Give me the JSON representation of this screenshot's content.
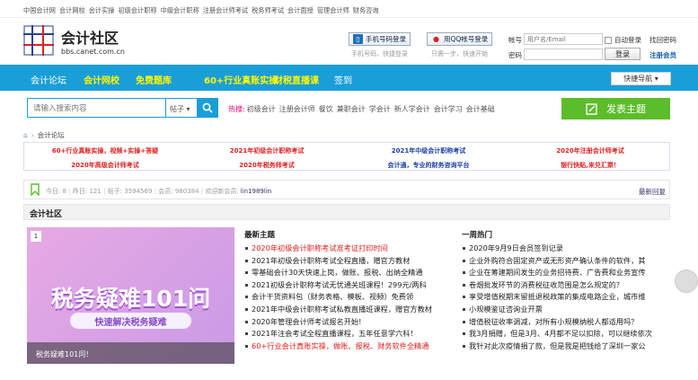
{
  "topbar": {
    "links": [
      "中国会计网",
      "会计网校",
      "会计实操",
      "初级会计职称",
      "中级会计职称",
      "注册会计师考试",
      "税务师考试",
      "会计面授",
      "管理会计师",
      "财务咨询"
    ]
  },
  "logo": {
    "title": "会计社区",
    "domain": "bbs.canet.com.cn"
  },
  "login": {
    "phone_btn": "手机号码登录",
    "phone_sub": "手机号码，快捷登录",
    "qq_btn": "用QQ帐号登录",
    "qq_sub": "只需一步，快速开始",
    "acct_label": "帐号",
    "acct_placeholder": "用户名/Email",
    "auto_login": "自动登录",
    "find_pwd": "找回密码",
    "pwd_label": "密码",
    "login_btn": "登录",
    "register": "注册会员"
  },
  "nav": {
    "items": [
      {
        "label": "会计论坛",
        "hl": false
      },
      {
        "label": "会计网校",
        "hl": true
      },
      {
        "label": "免费题库",
        "hl": true
      },
      {
        "label": "60+行业真账实操",
        "hl": true
      },
      {
        "label": "财税直播课",
        "hl": true
      },
      {
        "label": "签到",
        "hl": false
      }
    ],
    "quick": "快捷导航"
  },
  "search": {
    "placeholder": "请输入搜索内容",
    "select": "帖子",
    "hot_label": "热搜:",
    "hot": [
      "初级会计",
      "注册会计师",
      "餐饮",
      "兼职会计",
      "学会计",
      "新人学会计",
      "会计学习",
      "会计基础"
    ],
    "post_btn": "发表主题"
  },
  "breadcrumb": {
    "current": "会计论坛"
  },
  "promo": [
    {
      "text": "60+行业真账实操，视频+实操+答疑",
      "color": "#e02020"
    },
    {
      "text": "2021年初级会计职称考试",
      "color": "#e02020"
    },
    {
      "text": "2021年中级会计职称考试",
      "color": "#1a3ea8"
    },
    {
      "text": "2020年注册会计师考试",
      "color": "#e02020"
    },
    {
      "text": "2020年高级会计师考试",
      "color": "#e02020"
    },
    {
      "text": "2020年税务师考试",
      "color": "#e02020"
    },
    {
      "text": "会计通，专业的财务咨询平台",
      "color": "#1a3ea8"
    },
    {
      "text": "银行快贴,来兑汇票！",
      "color": "#e02020"
    }
  ],
  "stats": {
    "today_label": "今日: 8",
    "yest": "昨日: 121",
    "posts": "帖子: 3594569",
    "members": "会员: 980384",
    "welcome": "欢迎新会员:",
    "newest": "lin1989lin",
    "latest": "最新回复"
  },
  "section": {
    "title": "会计社区"
  },
  "banner": {
    "index": "1",
    "big": "税务疑难101问",
    "small": "快速解决税务疑难",
    "caption": "税务疑难101问！"
  },
  "new_topics": {
    "title": "最新主题",
    "items": [
      {
        "text": "2020年初级会计职称考试准考证打印时间",
        "red": true
      },
      {
        "text": "2021年初级会计职称考试全程直播，赠官方教材",
        "red": false
      },
      {
        "text": "零基础会计30天快速上岗，做账、报税、出纳全精通",
        "red": false
      },
      {
        "text": "2021初级会计职称考试无忧通关班课程！299元/两科",
        "red": false
      },
      {
        "text": "会计干货资料包（财务表格、模板、视频）免费领",
        "red": false
      },
      {
        "text": "2021年中级会计职称考试私教直播班课程，赠官方教材",
        "red": false
      },
      {
        "text": "2020年管理会计师考试报名开始!",
        "red": false
      },
      {
        "text": "2021年注会考试全程直播课程，五年任意学六科！",
        "red": false
      },
      {
        "text": "60+行业会计真账实操，做账、报税、财务软件全精通",
        "red": true
      }
    ]
  },
  "weekly": {
    "title": "一周热门",
    "items": [
      "2020年9月9日会员签到记录",
      "企业外购符合固定资产或无形资产确认条件的软件，其",
      "企业在筹建期间发生的业务招待费、广告费和业务宣传",
      "卷烟批发环节的消费税征收范围是怎么规定的？",
      "享受增值税期末留抵退税政策的集成电路企业，城市维",
      "小规模鉴证咨询业开票",
      "增值税征收率调减，对所有小规模纳税人都适用吗？",
      "我3月捐赠，但是3月、4月都不足以扣除，可以继续依次",
      "我针对此次疫情捐了款，但是我是把钱给了深圳一家公"
    ]
  },
  "colors": {
    "nav": "#1a9ed8",
    "accent_red": "#e02020",
    "post_green": "#5cbd2b"
  }
}
